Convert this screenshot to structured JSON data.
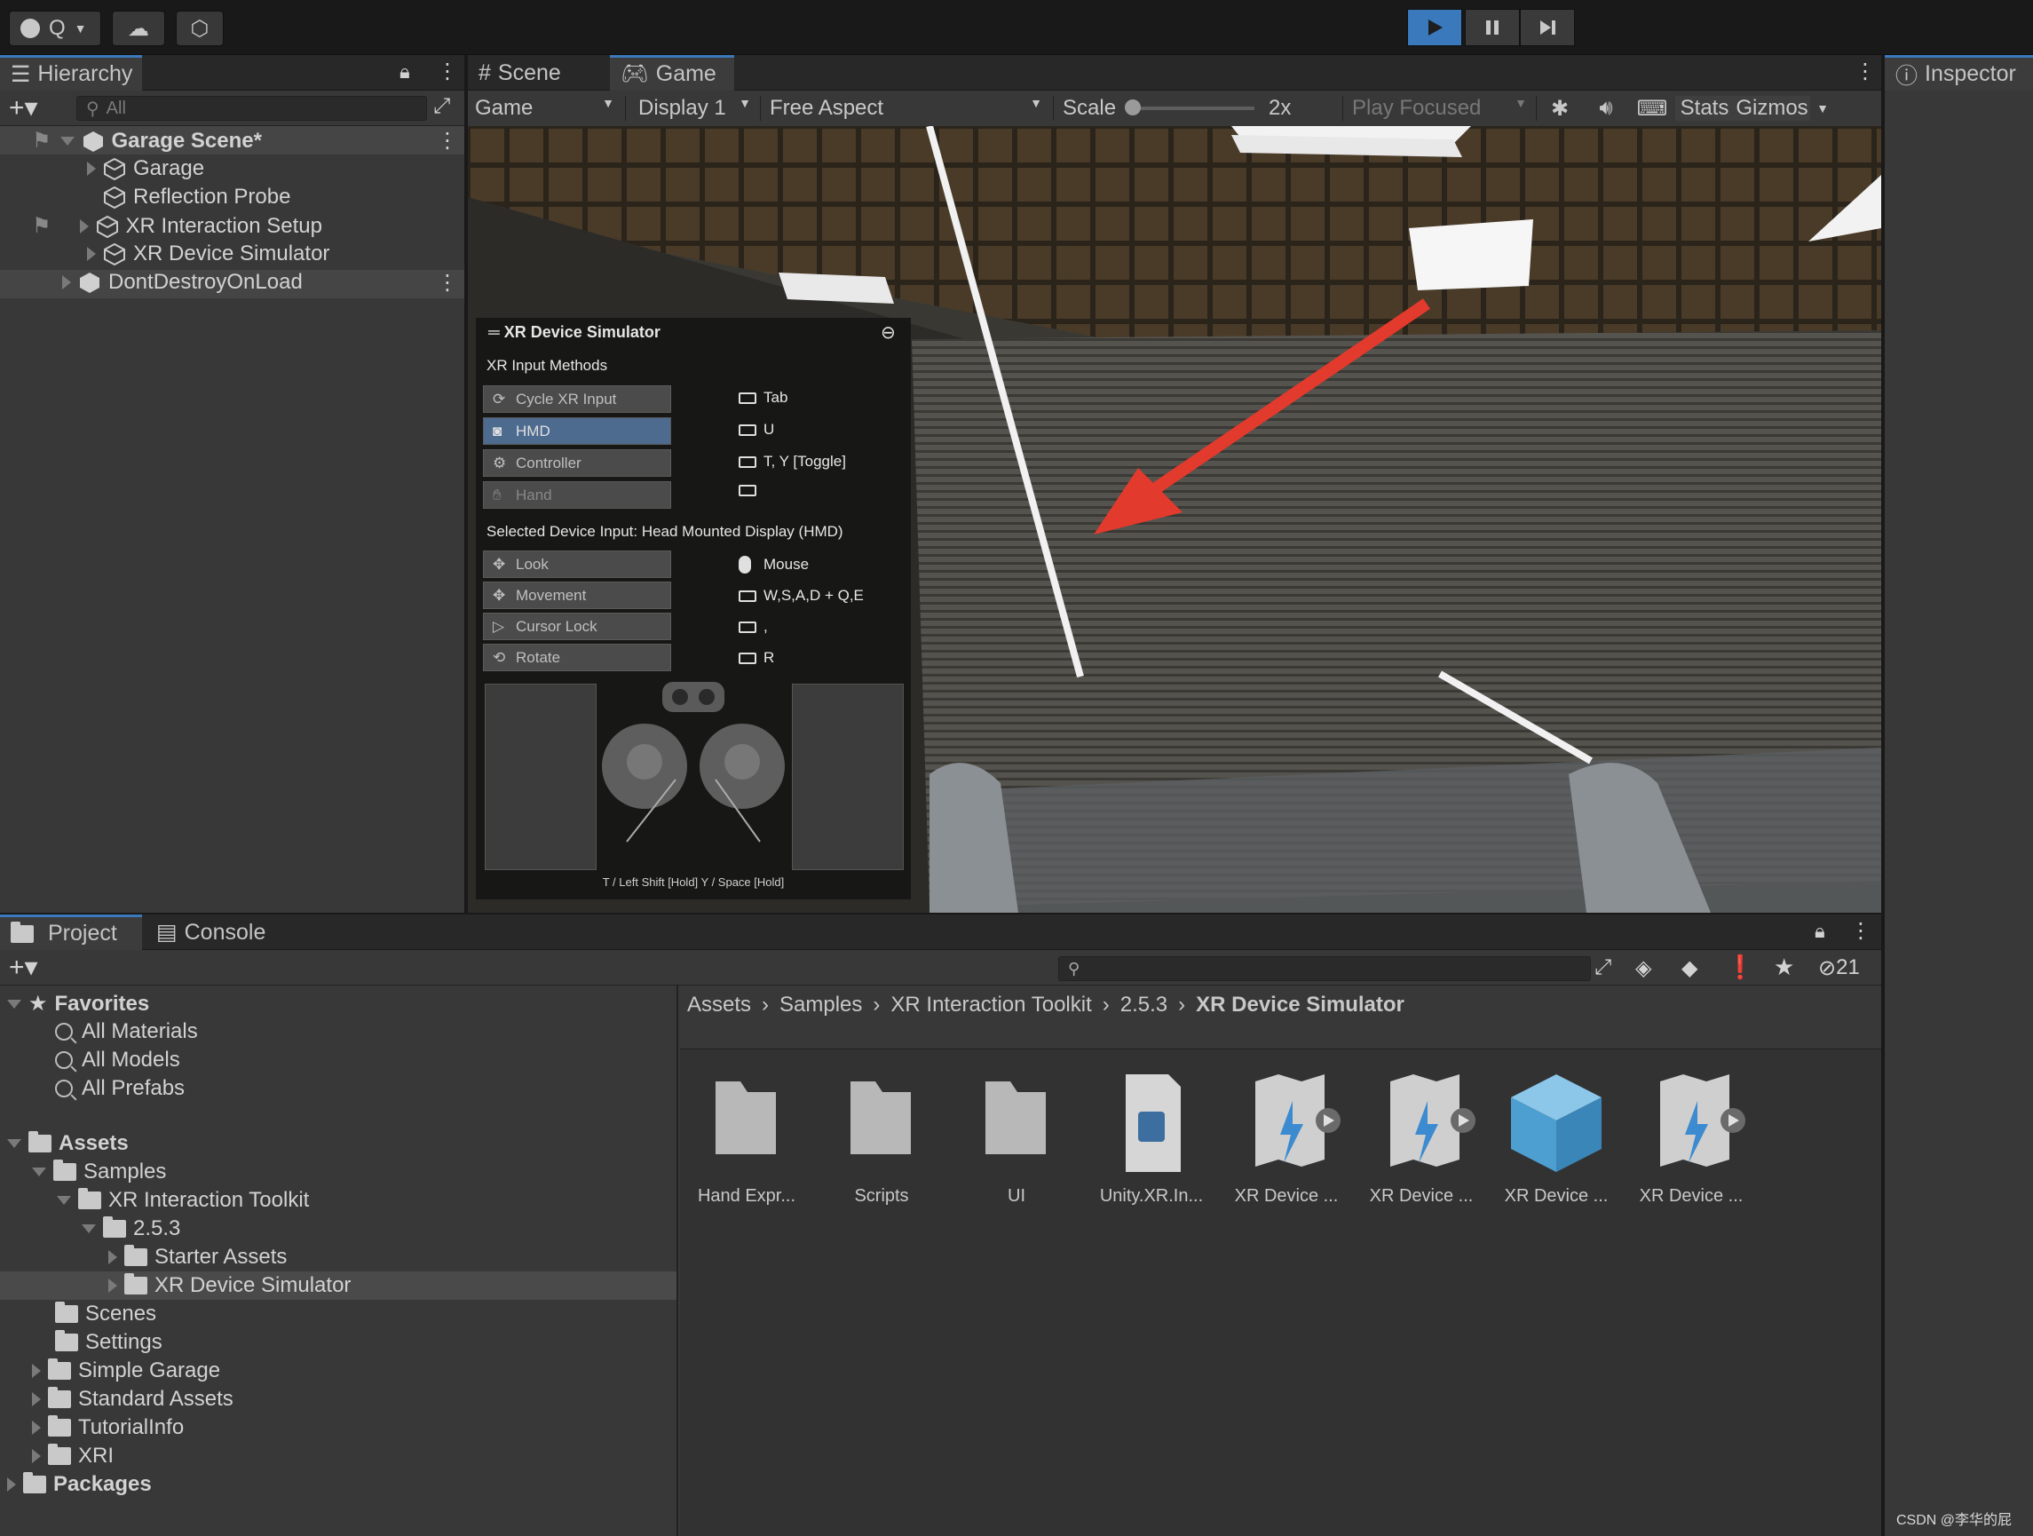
{
  "toolbar": {
    "account_label": "Q",
    "play_icon": "play-icon",
    "pause_icon": "pause-icon",
    "step_icon": "step-icon"
  },
  "hierarchy": {
    "tab_label": "Hierarchy",
    "search_placeholder": "All",
    "items": [
      {
        "label": "Garage Scene*"
      },
      {
        "label": "Garage"
      },
      {
        "label": "Reflection Probe"
      },
      {
        "label": "XR Interaction Setup"
      },
      {
        "label": "XR Device Simulator"
      },
      {
        "label": "DontDestroyOnLoad"
      }
    ]
  },
  "scene_tabs": {
    "scene": "Scene",
    "game": "Game"
  },
  "game_toolbar": {
    "mode": "Game",
    "display": "Display 1",
    "aspect": "Free Aspect",
    "scale_label": "Scale",
    "scale_value": "2x",
    "play_focused": "Play Focused",
    "stats": "Stats",
    "gizmos": "Gizmos"
  },
  "inspector": {
    "tab_label": "Inspector"
  },
  "simulator": {
    "title": "XR Device Simulator",
    "input_methods_label": "XR Input Methods",
    "input_methods": [
      {
        "button": "Cycle XR Input",
        "key": "Tab"
      },
      {
        "button": "HMD",
        "key": "U"
      },
      {
        "button": "Controller",
        "key": "T, Y [Toggle]"
      },
      {
        "button": "Hand",
        "key": ""
      }
    ],
    "selected_label": "Selected Device Input: Head Mounted Display (HMD)",
    "device_inputs": [
      {
        "button": "Look",
        "key": "Mouse"
      },
      {
        "button": "Movement",
        "key": "W,S,A,D + Q,E"
      },
      {
        "button": "Cursor Lock",
        "key": ","
      },
      {
        "button": "Rotate",
        "key": "R"
      }
    ],
    "footer": "T / Left Shift [Hold]   Y / Space [Hold]"
  },
  "project": {
    "tab_project": "Project",
    "tab_console": "Console",
    "hidden_count": "21",
    "favorites": {
      "label": "Favorites",
      "items": [
        "All Materials",
        "All Models",
        "All Prefabs"
      ]
    },
    "tree": [
      {
        "label": "Assets"
      },
      {
        "label": "Samples"
      },
      {
        "label": "XR Interaction Toolkit"
      },
      {
        "label": "2.5.3"
      },
      {
        "label": "Starter Assets"
      },
      {
        "label": "XR Device Simulator"
      },
      {
        "label": "Scenes"
      },
      {
        "label": "Settings"
      },
      {
        "label": "Simple Garage"
      },
      {
        "label": "Standard Assets"
      },
      {
        "label": "TutorialInfo"
      },
      {
        "label": "XRI"
      },
      {
        "label": "Packages"
      }
    ],
    "breadcrumb": [
      "Assets",
      "Samples",
      "XR Interaction Toolkit",
      "2.5.3",
      "XR Device Simulator"
    ],
    "assets": [
      {
        "label": "Hand Expr...",
        "icon": "folder-icon"
      },
      {
        "label": "Scripts",
        "icon": "folder-icon"
      },
      {
        "label": "UI",
        "icon": "folder-icon"
      },
      {
        "label": "Unity.XR.In...",
        "icon": "asmdef-icon"
      },
      {
        "label": "XR Device ...",
        "icon": "input-actions-icon"
      },
      {
        "label": "XR Device ...",
        "icon": "input-actions-icon"
      },
      {
        "label": "XR Device ...",
        "icon": "prefab-icon"
      },
      {
        "label": "XR Device ...",
        "icon": "input-actions-icon"
      }
    ]
  },
  "watermark": "CSDN @李华的屁"
}
